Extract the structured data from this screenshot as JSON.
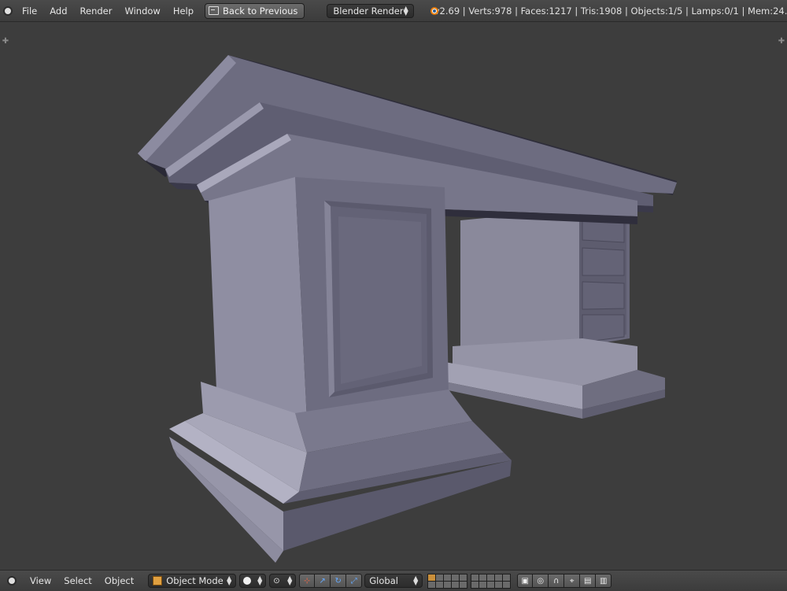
{
  "top_header": {
    "menus": [
      "File",
      "Add",
      "Render",
      "Window",
      "Help"
    ],
    "back_button": "Back to Previous",
    "render_engine": "Blender Render",
    "stats": "v2.69 | Verts:978 | Faces:1217 | Tris:1908 | Objects:1/5 | Lamps:0/1 | Mem:24."
  },
  "bottom_header": {
    "menus": [
      "View",
      "Select",
      "Object"
    ],
    "mode": "Object Mode",
    "transform_orientation": "Global"
  },
  "icons": {
    "editor_type": "editor-type-icon",
    "back": "back-icon",
    "blender_logo": "blender-logo-icon",
    "mode": "object-mode-cube-icon",
    "viewport_shading": "solid-shading-sphere-icon",
    "pivot": "pivot-point-icon",
    "manipulator": "manipulator-icon",
    "translate": "translate-icon",
    "rotate": "rotate-icon",
    "scale": "scale-icon",
    "lock_camera": "lock-layers-icon",
    "snap": "snap-magnet-icon",
    "render_still": "render-icon",
    "render_anim": "render-animation-icon"
  },
  "colors": {
    "viewport_bg": "#3d3d3d",
    "model_base": "#7b7a8c",
    "accent": "#e87d0d"
  }
}
